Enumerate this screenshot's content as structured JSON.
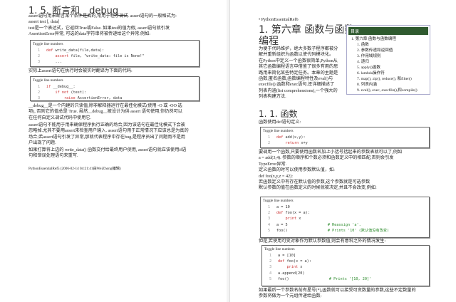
{
  "left": {
    "title": "1. 5.   断言和__debug__",
    "paras1": [
      "assert语句用来断言某个条件是真的,常用于程序调试. assert语句的一般格式为:",
      "assert test [, data]",
      "test是一个表达式，它返回True或False. 如果test的值为假, assert语句就引发",
      "AssertionError异常, 可选的data字符串将被传递给这个异常.例如:"
    ],
    "toggle": "Toggle line numbers",
    "code1": [
      [
        "1",
        "def write_data(file,data):"
      ],
      [
        "2",
        "    assert file, \"write_data: file is None!\""
      ],
      [
        "3",
        "    ..."
      ]
    ],
    "mid": "实际上assert语句在执行时会被实时翻译为下面的代码:",
    "code2": [
      [
        "1",
        "if __debug__:"
      ],
      [
        "2",
        "    if not (test):"
      ],
      [
        "3",
        "        raise AssertionError, data"
      ]
    ],
    "paras2": [
      "__debug__是一个内建的只读值,除非解释器运行在最佳化模式(使用 -O 或 -OO 选",
      "项), 否则它的值总是 True. 虽然__debug__被设计为供 assert 语句使用,你仍然可以",
      "在任何自定义调试代码中使用它."
    ],
    "paras3": [
      "assert语句不能用于用来确保程序执行正确的场合,因为该语句在最佳化模式下会被",
      "忽略掉.尤其不要用assert来检查用户输入. assert语句用于正常情况下应该总是为真的",
      "场合;若assert语句引发了异常,那就代表程序中存在bug,是程序员出了问题而不是用",
      "户出现了问题."
    ],
    "paras4": [
      "如果打算将上边的 write_data() 函数交付给最终用户使用, assert语句就应该使用if语",
      "句和错误处理语句来重写."
    ],
    "footer": "PythonEssentialRef5 (2006-02-14 04:21:41由WeiZhong编辑)"
  },
  "right": {
    "bullet": "PythonEssentialRef6",
    "title1": "1.  第六章  函数与函数",
    "title2": "编程",
    "intro": [
      "为便于代码维护，绝大多数子程序都被分",
      "解并重新组织为函数以使代码模块化。",
      "在Python中定义一个函数很简单,Python从",
      "其它函数编程语言中借鉴了很多有用的思",
      "路用来简化某些特定任务。本章的主题是",
      "函数,匿名函数,函数编程特性及eval()与",
      "execfile() 函数和exec语句.还详细描述了",
      "列表内涵(list comprehensions),一个强大的",
      "列表构建方法."
    ],
    "toc": {
      "header": "目录",
      "top": "1. 第六章 函数与函数编程",
      "items": [
        "1. 函数",
        "2. 参数传递和返回值",
        "3. 作用域规则",
        "4. 递归",
        "5. apply()函数",
        "6. lambda操作符",
        "7. map(), zip(), reduce(), 和filter()",
        "8. 列表内涵",
        "9. eval(), exec, execfile(),和compile()"
      ]
    },
    "sec": "1. 1.   函数",
    "p1": "函数使用def语句定义:",
    "toggle": "Toggle line numbers",
    "code1": [
      [
        "1",
        "def add(x,y):"
      ],
      [
        "2",
        "    return x+y"
      ]
    ],
    "p2": [
      "要调用一个函数,只要使用函数名加上小括号括起来的参数表就可以了,例如",
      "a = add(3,4). 参数的顺序和个数必须和函数定义中的相匹配,否则会引发",
      "TypeError异常.",
      "定义函数的时可以使用参数默认值，如:",
      "def foo(x,y,z = 42):",
      "若函数定义中有存在默认值的参数,这个参数就是可选参数",
      "默认参数的值在函数定义的时候就被决定,并且不会改变,例如:"
    ],
    "code2": [
      [
        "1",
        "a = 10"
      ],
      [
        "2",
        "def foo(x = a):"
      ],
      [
        "3",
        "    print x"
      ],
      [
        "4",
        "a = 5                  # Reassign 'a'."
      ],
      [
        "5",
        "foo()                  # Prints '10' (默认值没有改变)"
      ]
    ],
    "p3": "但是,若使用可变对象作为默认参数值,则会有意料之外的情况发生:",
    "code3": [
      [
        "1",
        "a = [10]"
      ],
      [
        "2",
        "def foo(x = a):"
      ],
      [
        "3",
        "    print x"
      ],
      [
        "4",
        "a.append(20)"
      ],
      [
        "5",
        "foo()                  # Prints '[10, 20]'"
      ]
    ],
    "p4": [
      "如果最后一个参数名前有星号(*),函数就可以接受可变数量的参数,这些不定数量的",
      "参数将做为一个元组传递给函数:"
    ]
  }
}
